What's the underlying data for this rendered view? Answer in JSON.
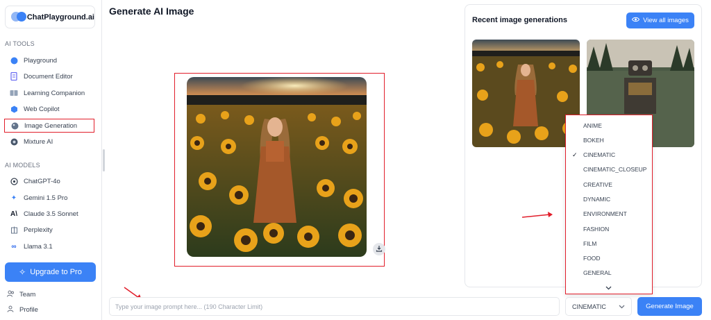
{
  "brand": {
    "name": "ChatPlayground.ai"
  },
  "sidebar": {
    "tools_label": "AI TOOLS",
    "tools": [
      {
        "label": "Playground",
        "icon": "chat-bubble-icon"
      },
      {
        "label": "Document Editor",
        "icon": "document-icon"
      },
      {
        "label": "Learning Companion",
        "icon": "book-icon"
      },
      {
        "label": "Web Copilot",
        "icon": "globe-icon"
      },
      {
        "label": "Image Generation",
        "icon": "image-icon"
      },
      {
        "label": "Mixture AI",
        "icon": "blend-icon"
      }
    ],
    "models_label": "AI MODELS",
    "models": [
      {
        "label": "ChatGPT-4o",
        "icon": "openai-icon"
      },
      {
        "label": "Gemini 1.5 Pro",
        "icon": "gemini-icon"
      },
      {
        "label": "Claude 3.5 Sonnet",
        "icon": "anthropic-icon"
      },
      {
        "label": "Perplexity",
        "icon": "perplexity-icon"
      },
      {
        "label": "Llama 3.1",
        "icon": "meta-icon"
      }
    ],
    "upgrade_label": "Upgrade to Pro",
    "footer": [
      {
        "label": "Team",
        "icon": "team-icon"
      },
      {
        "label": "Profile",
        "icon": "profile-icon"
      }
    ]
  },
  "main": {
    "title": "Generate AI Image"
  },
  "recent": {
    "title": "Recent image generations",
    "view_all_label": "View all images"
  },
  "style_dropdown": {
    "options": [
      "ANIME",
      "BOKEH",
      "CINEMATIC",
      "CINEMATIC_CLOSEUP",
      "CREATIVE",
      "DYNAMIC",
      "ENVIRONMENT",
      "FASHION",
      "FILM",
      "FOOD",
      "GENERAL"
    ],
    "selected": "CINEMATIC"
  },
  "prompt": {
    "placeholder": "Type your image prompt here... (190 Character Limit)",
    "value": ""
  },
  "generate_label": "Generate Image",
  "colors": {
    "accent": "#3b82f6",
    "annotation": "#e11d2a"
  }
}
